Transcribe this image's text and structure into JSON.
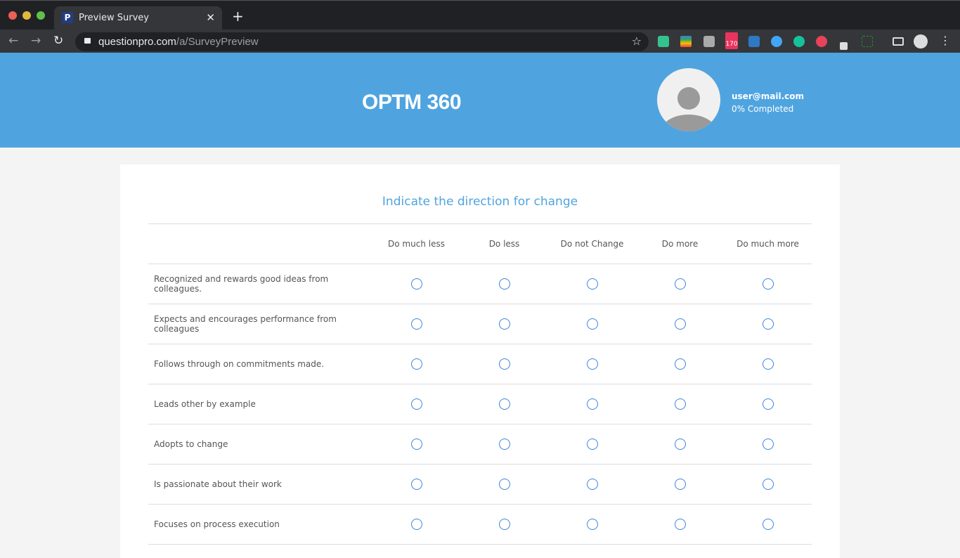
{
  "browser": {
    "tab_title": "Preview Survey",
    "favicon": "P",
    "url_host": "questionpro.com",
    "url_path": "/a/SurveyPreview",
    "badge_count": "170"
  },
  "header": {
    "title": "OPTM 360",
    "email": "user@mail.com",
    "progress": "0% Completed",
    "progress_percent": 0
  },
  "question": {
    "title": "Indicate the direction for change",
    "columns": [
      "Do much less",
      "Do less",
      "Do not Change",
      "Do more",
      "Do much more"
    ],
    "rows": [
      "Recognized and rewards good ideas from colleagues.",
      "Expects and encourages performance from colleagues",
      "Follows through on commitments made.",
      "Leads other by example",
      "Adopts to change",
      "Is passionate about their work",
      "Focuses on process execution"
    ]
  },
  "colors": {
    "accent": "#4fa4e0",
    "radio": "#3b87d9"
  }
}
